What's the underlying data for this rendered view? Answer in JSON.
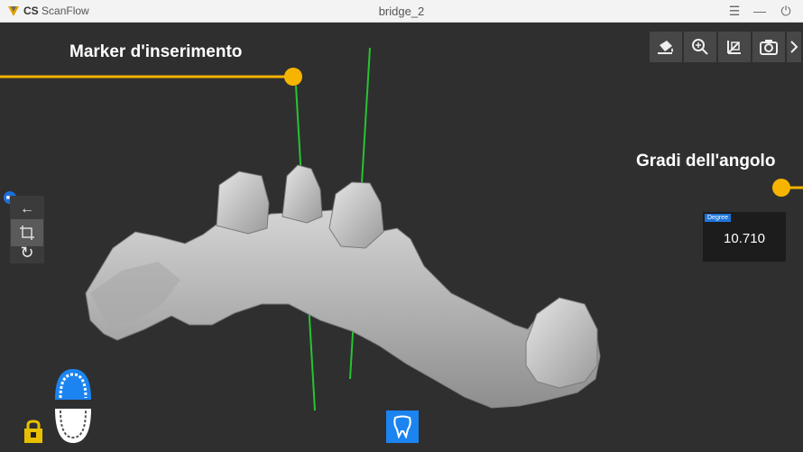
{
  "titlebar": {
    "app_name_prefix": "CS",
    "app_name": "ScanFlow",
    "document_title": "bridge_2",
    "menu_glyph": "☰",
    "minimize_glyph": "—",
    "power_glyph": "⏻"
  },
  "callouts": {
    "insertion_marker": "Marker d'inserimento",
    "angle_degrees": "Gradi dell'angolo"
  },
  "degree_readout": {
    "tag": "Degree",
    "value": "10.710"
  },
  "side_panel": {
    "badge": "■■",
    "back_glyph": "←",
    "rotate_glyph": "↻"
  },
  "toolbar": {
    "icons": [
      "bucket-icon",
      "zoom-icon",
      "axes-icon",
      "camera-icon",
      "chevron-right-icon"
    ]
  },
  "colors": {
    "callout_yellow": "#f6b400",
    "axis_green": "#27c431",
    "accent_blue": "#1c84f0",
    "model_gray": "#b8b8b8"
  }
}
